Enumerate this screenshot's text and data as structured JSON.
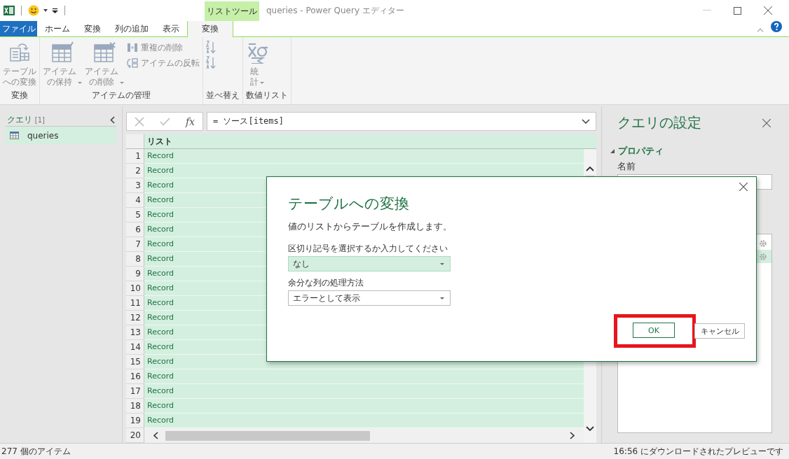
{
  "window": {
    "title": "queries - Power Query エディター",
    "context_tab": "リストツール"
  },
  "tabs": [
    {
      "label": "ファイル",
      "kind": "file",
      "selected": false
    },
    {
      "label": "ホーム",
      "kind": "tab",
      "selected": false
    },
    {
      "label": "変換",
      "kind": "tab",
      "selected": false
    },
    {
      "label": "列の追加",
      "kind": "tab",
      "selected": false
    },
    {
      "label": "表示",
      "kind": "tab",
      "selected": false
    },
    {
      "label": "変換",
      "kind": "tab",
      "selected": true
    }
  ],
  "ribbon": [
    {
      "group": "変換",
      "buttons": [
        {
          "kind": "large",
          "lines": [
            "テーブル",
            "への変換"
          ],
          "dropdown": false,
          "disabled": true
        }
      ]
    },
    {
      "group": "アイテムの管理",
      "buttons": [
        {
          "kind": "large",
          "lines": [
            "アイテム",
            "の保持"
          ],
          "dropdown": true,
          "disabled": true
        },
        {
          "kind": "large",
          "lines": [
            "アイテム",
            "の削除"
          ],
          "dropdown": true,
          "disabled": true
        },
        {
          "kind": "stack",
          "items": [
            {
              "label": "重複の削除",
              "disabled": true
            },
            {
              "label": "アイテムの反転",
              "disabled": true
            }
          ]
        }
      ]
    },
    {
      "group": "並べ替え",
      "buttons": [
        {
          "kind": "stack",
          "items": [
            {
              "disabled": true
            },
            {
              "disabled": true
            }
          ]
        }
      ]
    },
    {
      "group": "数値リスト",
      "buttons": [
        {
          "kind": "large",
          "lines": [
            "統",
            "計"
          ],
          "dropdown": true,
          "disabled": true
        }
      ]
    }
  ],
  "queries_pane": {
    "title": "クエリ",
    "count": "[1]",
    "items": [
      {
        "name": "queries",
        "selected": true
      }
    ]
  },
  "formula_bar": {
    "fx": "fx",
    "formula": "= ソース[items]"
  },
  "table": {
    "columns": [
      {
        "name": "リスト",
        "selected": true
      }
    ],
    "rows": [
      {
        "n": "1",
        "value": "Record"
      },
      {
        "n": "2",
        "value": "Record"
      },
      {
        "n": "3",
        "value": "Record"
      },
      {
        "n": "4",
        "value": "Record"
      },
      {
        "n": "5",
        "value": "Record"
      },
      {
        "n": "6",
        "value": "Record"
      },
      {
        "n": "7",
        "value": "Record"
      },
      {
        "n": "8",
        "value": "Record"
      },
      {
        "n": "9",
        "value": "Record"
      },
      {
        "n": "10",
        "value": "Record"
      },
      {
        "n": "11",
        "value": "Record"
      },
      {
        "n": "12",
        "value": "Record"
      },
      {
        "n": "13",
        "value": "Record"
      },
      {
        "n": "14",
        "value": "Record"
      },
      {
        "n": "15",
        "value": "Record"
      },
      {
        "n": "16",
        "value": "Record"
      },
      {
        "n": "17",
        "value": "Record"
      },
      {
        "n": "18",
        "value": "Record"
      },
      {
        "n": "19",
        "value": "Record"
      }
    ],
    "last_row_number": "20"
  },
  "settings_pane": {
    "title": "クエリの設定",
    "section": "プロパティ",
    "name_label": "名前",
    "steps": [
      {
        "selected": false
      },
      {
        "selected": true
      }
    ]
  },
  "dialog": {
    "title": "テーブルへの変換",
    "description": "値のリストからテーブルを作成します。",
    "fields": [
      {
        "label": "区切り記号を選択するか入力してください",
        "value": "なし",
        "focused": true
      },
      {
        "label": "余分な列の処理方法",
        "value": "エラーとして表示",
        "focused": false
      }
    ],
    "buttons": [
      {
        "label": "OK",
        "kind": "primary",
        "highlighted": true
      },
      {
        "label": "キャンセル",
        "kind": "secondary",
        "highlighted": false
      }
    ]
  },
  "status_bar": {
    "left": "277 個のアイテム",
    "right": "16:56 にダウンロードされたプレビューです"
  }
}
